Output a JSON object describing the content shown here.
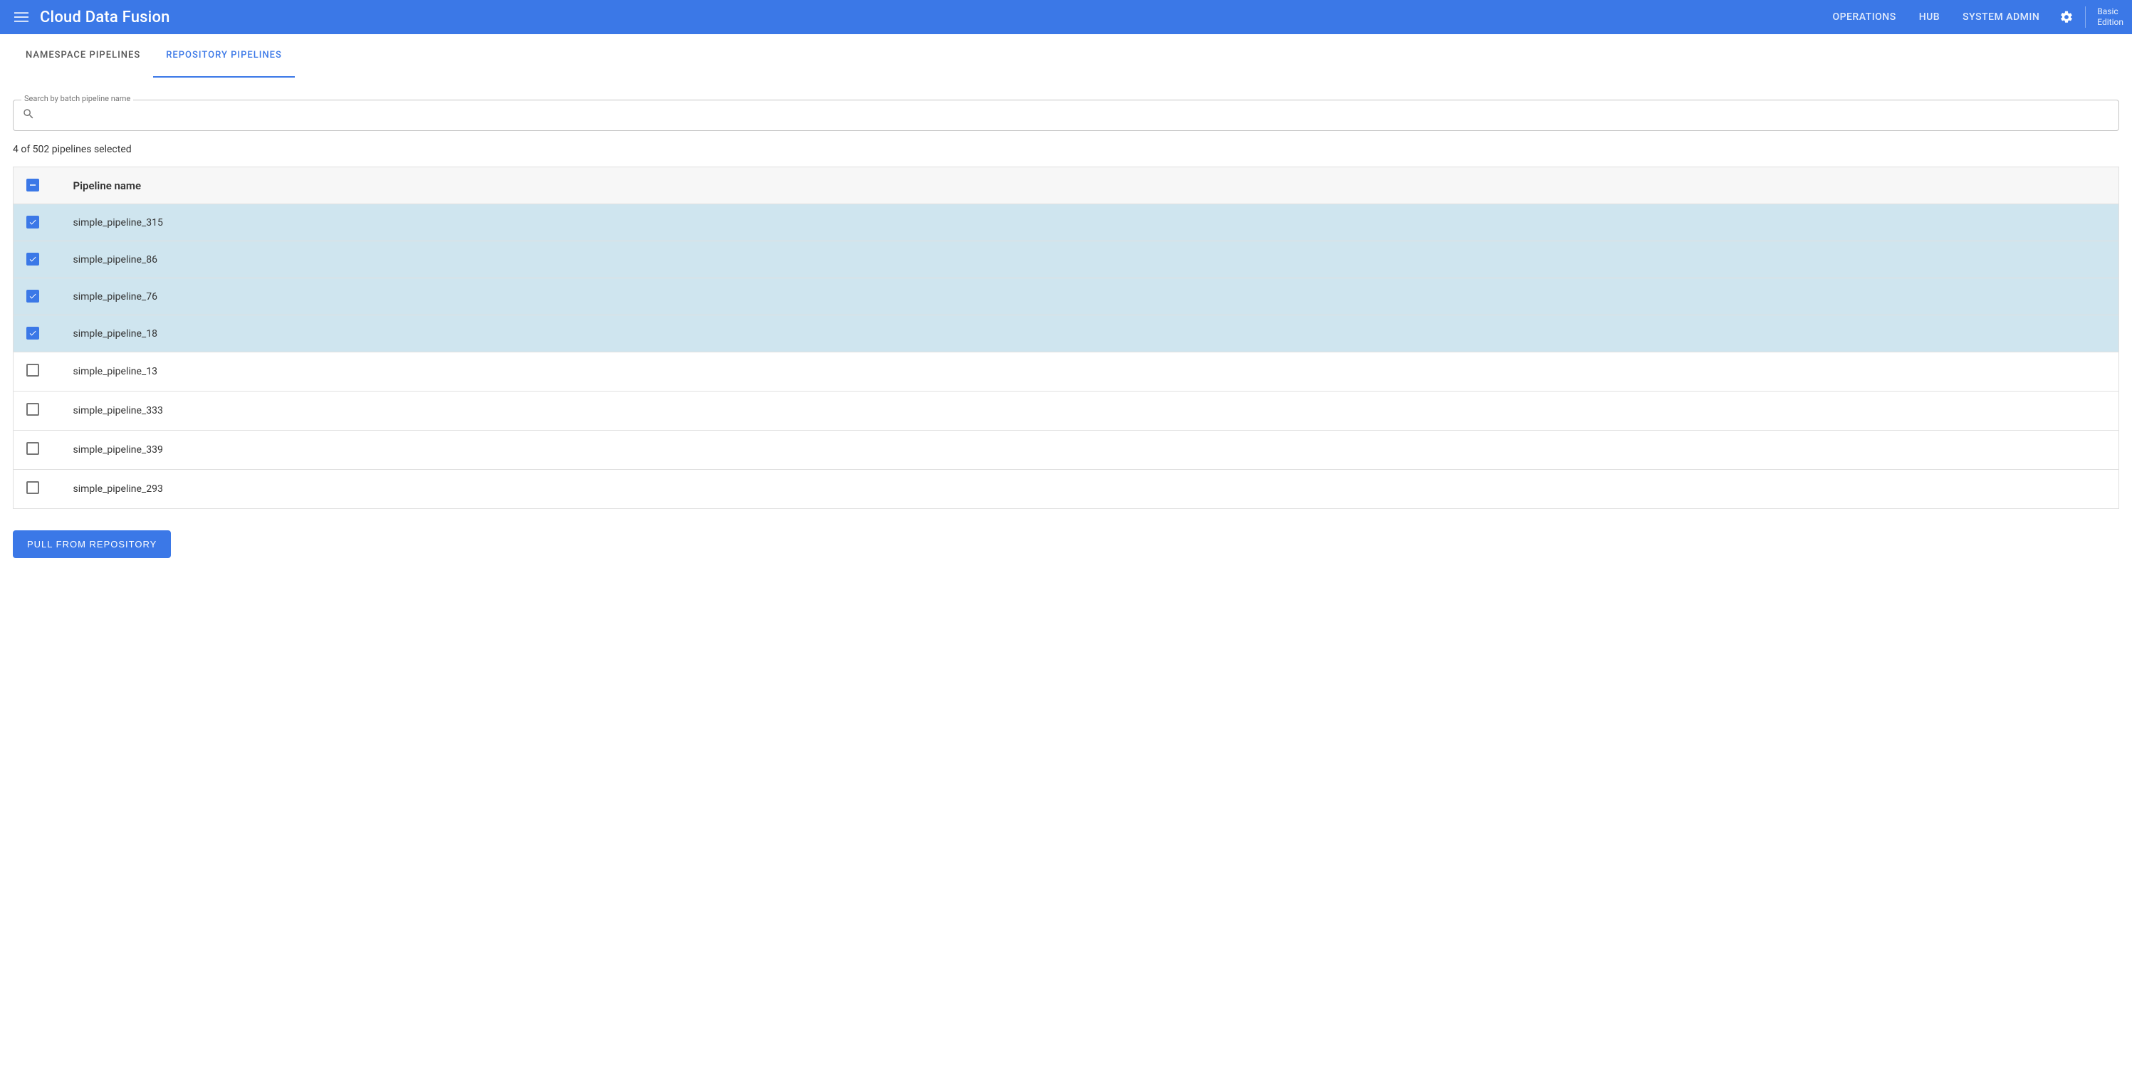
{
  "header": {
    "brand": "Cloud Data Fusion",
    "nav": [
      {
        "label": "OPERATIONS"
      },
      {
        "label": "HUB"
      },
      {
        "label": "SYSTEM ADMIN"
      }
    ],
    "edition_line1": "Basic",
    "edition_line2": "Edition"
  },
  "tabs": [
    {
      "label": "NAMESPACE PIPELINES",
      "active": false
    },
    {
      "label": "REPOSITORY PIPELINES",
      "active": true
    }
  ],
  "search": {
    "label": "Search by batch pipeline name",
    "value": ""
  },
  "selection_text": "4 of 502 pipelines selected",
  "table": {
    "header": "Pipeline name",
    "rows": [
      {
        "name": "simple_pipeline_315",
        "selected": true
      },
      {
        "name": "simple_pipeline_86",
        "selected": true
      },
      {
        "name": "simple_pipeline_76",
        "selected": true
      },
      {
        "name": "simple_pipeline_18",
        "selected": true
      },
      {
        "name": "simple_pipeline_13",
        "selected": false
      },
      {
        "name": "simple_pipeline_333",
        "selected": false
      },
      {
        "name": "simple_pipeline_339",
        "selected": false
      },
      {
        "name": "simple_pipeline_293",
        "selected": false
      }
    ]
  },
  "actions": {
    "pull_button": "PULL FROM REPOSITORY"
  }
}
